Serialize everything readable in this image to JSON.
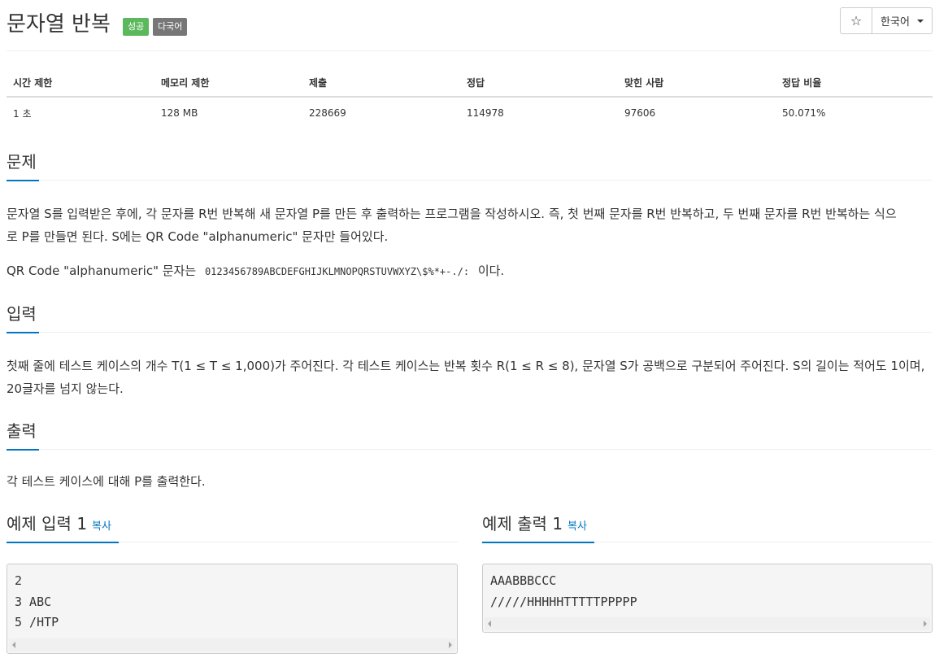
{
  "header": {
    "title": "문자열 반복",
    "badge_success": "성공",
    "badge_multilang": "다국어",
    "star_icon": "☆",
    "language_label": "한국어"
  },
  "info_table": {
    "headers": [
      "시간 제한",
      "메모리 제한",
      "제출",
      "정답",
      "맞힌 사람",
      "정답 비율"
    ],
    "values": [
      "1 초",
      "128 MB",
      "228669",
      "114978",
      "97606",
      "50.071%"
    ]
  },
  "sections": {
    "problem": {
      "title": "문제",
      "line1": "문자열 S를 입력받은 후에, 각 문자를 R번 반복해 새 문자열 P를 만든 후 출력하는 프로그램을 작성하시오. 즉, 첫 번째 문자를 R번 반복하고, 두 번째 문자를 R번 반복하는 식으",
      "line2": "로 P를 만들면 된다. S에는 QR Code \"alphanumeric\" 문자만 들어있다.",
      "charset_prefix": "QR Code \"alphanumeric\" 문자는",
      "charset": "0123456789ABCDEFGHIJKLMNOPQRSTUVWXYZ\\$%*+-./:",
      "charset_suffix": "이다."
    },
    "input": {
      "title": "입력",
      "line1": "첫째 줄에 테스트 케이스의 개수 T(1 ≤ T ≤ 1,000)가 주어진다. 각 테스트 케이스는 반복 횟수 R(1 ≤ R ≤ 8), 문자열 S가 공백으로 구분되어 주어진다. S의 길이는 적어도 1이며,",
      "line2": "20글자를 넘지 않는다."
    },
    "output": {
      "title": "출력",
      "line1": "각 테스트 케이스에 대해 P를 출력한다."
    }
  },
  "samples": {
    "input": {
      "title": "예제 입력 1",
      "copy_label": "복사",
      "lines": [
        "2",
        "3 ABC",
        "5 /HTP"
      ]
    },
    "output": {
      "title": "예제 출력 1",
      "copy_label": "복사",
      "lines": [
        "AAABBBCCC",
        "/////HHHHHTTTTTPPPPP"
      ]
    }
  },
  "colors": {
    "accent": "#0076c0",
    "success_badge": "#5cb85c",
    "multilang_badge": "#777777"
  }
}
